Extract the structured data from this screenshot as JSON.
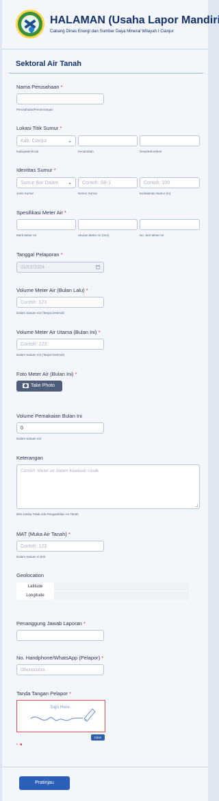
{
  "header": {
    "title": "HALAMAN (Usaha Lapor Mandiri)",
    "subtitle": "Cabang Dinas Energi dan Sumber Daya Mineral Wilayah I Cianjur"
  },
  "section": {
    "title": "Sektoral Air Tanah"
  },
  "nama_perusahaan": {
    "label": "Nama Perusahaan",
    "required": "*",
    "value": "",
    "help": "Perusahaan/Perseorangan"
  },
  "lokasi": {
    "label": "Lokasi Titik Sumur",
    "required": "*",
    "kabupaten": {
      "value": "Kab. Cianjur",
      "help": "Kabupaten/Kota"
    },
    "kecamatan": {
      "value": "",
      "help": "Kecamatan"
    },
    "desa": {
      "value": "",
      "help": "Desa/Kelurahan"
    }
  },
  "identitas": {
    "label": "Identitas Sumur",
    "required": "*",
    "jenis": {
      "value": "Sumur Bor Dalam",
      "help": "Jenis Sumur"
    },
    "nomor": {
      "placeholder": "Contoh: SB-1",
      "help": "Nomor Sumur"
    },
    "kedalaman": {
      "placeholder": "Contoh: 100",
      "help": "Kedalaman Sumur (m)"
    }
  },
  "spesifikasi": {
    "label": "Spesifikasi Meter Air",
    "required": "*",
    "merk": {
      "help": "Merk Meter Air"
    },
    "ukuran": {
      "help": "Ukuran Meter Air (mm)"
    },
    "seri": {
      "help": "No. Seri Meter Air"
    }
  },
  "tanggal": {
    "label": "Tanggal Pelaporan",
    "required": "*",
    "value": "01/02/2024"
  },
  "volume_lalu": {
    "label": "Volume Meter Air (Bulan Lalu)",
    "required": "*",
    "placeholder": "Contoh: 123",
    "help": "Dalam Satuan m3 (Tanpa Desimal)"
  },
  "volume_ini": {
    "label": "Volume Meter Air Utama (Bulan Ini)",
    "required": "*",
    "placeholder": "Contoh: 123",
    "help": "Dalam Satuan m3 (Tanpa Desimal)"
  },
  "foto": {
    "label": "Foto Meter Air (Bulan Ini)",
    "required": "*",
    "button": "Take Photo"
  },
  "pemakaian": {
    "label": "Volume Pemakaian Bulan Ini",
    "value": "0",
    "help": "Dalam Satuan m3"
  },
  "keterangan": {
    "label": "Keterangan",
    "placeholder": "Contoh: Meter air dalam keadaan rusak",
    "help": "Diisi Ketika Tidak Ada Pengambilan Air Tanah"
  },
  "mat": {
    "label": "MAT (Muka Air Tanah)",
    "required": "*",
    "placeholder": "Contoh: 123",
    "help": "Dalam Satuan m bmt"
  },
  "geolocation": {
    "label": "Geolocation",
    "latitude": "Latitude",
    "longitude": "Longitude"
  },
  "penanggung": {
    "label": "Penanggung Jawab Laporan",
    "required": "*"
  },
  "handphone": {
    "label": "No. Handphone/WhatsApp (Pelapor)",
    "required": "*",
    "placeholder": "08xxxxxxxx"
  },
  "tanda_tangan": {
    "label": "Tanda Tangan Pelapor",
    "required": "*",
    "hint": "Sign Here",
    "clear": "Clear"
  },
  "submit": {
    "label": "Pratinjau"
  },
  "colors": {
    "accent": "#2d5fb8",
    "required": "#e02d2d",
    "title": "#14306a"
  }
}
